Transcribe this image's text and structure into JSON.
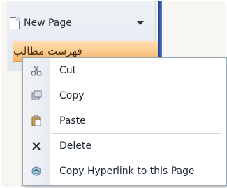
{
  "sidebar": {
    "new_page_label": "New Page",
    "rtl_page_title": "فهرست مطالب"
  },
  "context_menu": {
    "items": [
      {
        "label": "Cut",
        "icon": "scissors-icon"
      },
      {
        "label": "Copy",
        "icon": "copy-icon"
      },
      {
        "label": "Paste",
        "icon": "paste-icon"
      },
      {
        "label": "Delete",
        "icon": "delete-x-icon"
      },
      {
        "label": "Copy Hyperlink to this Page",
        "icon": "hyperlink-icon"
      }
    ]
  },
  "colors": {
    "tab_orange": "#f6b76a",
    "sidebar_blue": "#1c3d8a"
  }
}
